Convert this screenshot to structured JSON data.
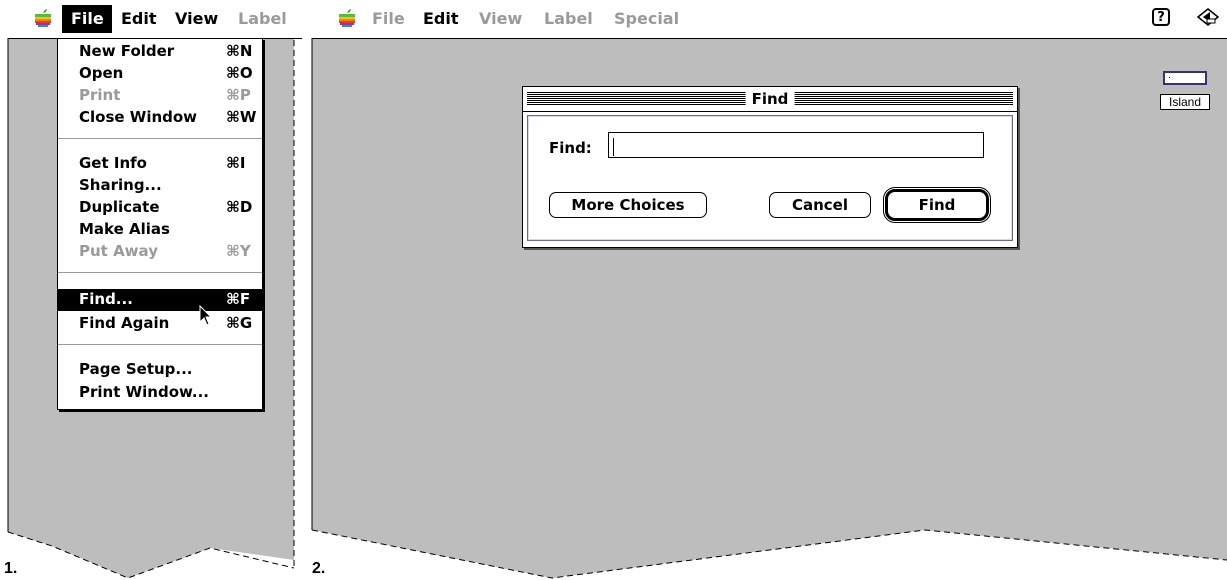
{
  "panel1": {
    "caption": "1.",
    "menubar": {
      "file": "File",
      "edit": "Edit",
      "view": "View",
      "label": "Label"
    },
    "file_menu": [
      {
        "label": "New Folder",
        "shortcut": "⌘N",
        "enabled": true
      },
      {
        "label": "Open",
        "shortcut": "⌘O",
        "enabled": true
      },
      {
        "label": "Print",
        "shortcut": "⌘P",
        "enabled": false
      },
      {
        "label": "Close Window",
        "shortcut": "⌘W",
        "enabled": true
      },
      {
        "label": "Get Info",
        "shortcut": "⌘I",
        "enabled": true
      },
      {
        "label": "Sharing...",
        "shortcut": "",
        "enabled": true
      },
      {
        "label": "Duplicate",
        "shortcut": "⌘D",
        "enabled": true
      },
      {
        "label": "Make Alias",
        "shortcut": "",
        "enabled": true
      },
      {
        "label": "Put Away",
        "shortcut": "⌘Y",
        "enabled": false
      },
      {
        "label": "Find...",
        "shortcut": "⌘F",
        "enabled": true,
        "highlighted": true
      },
      {
        "label": "Find Again",
        "shortcut": "⌘G",
        "enabled": true
      },
      {
        "label": "Page Setup...",
        "shortcut": "",
        "enabled": true
      },
      {
        "label": "Print Window...",
        "shortcut": "",
        "enabled": true
      }
    ]
  },
  "panel2": {
    "caption": "2.",
    "menubar": {
      "file": "File",
      "edit": "Edit",
      "view": "View",
      "label": "Label",
      "special": "Special"
    },
    "dialog": {
      "title": "Find",
      "field_label": "Find:",
      "field_value": "",
      "more_choices": "More Choices",
      "cancel": "Cancel",
      "find": "Find"
    },
    "help_icon": "?",
    "disk_label": "Island"
  },
  "colors": {
    "desktop": "#bdbdbd",
    "menu_dim": "#9a9a9a",
    "disk_border": "#3a2d7a"
  }
}
